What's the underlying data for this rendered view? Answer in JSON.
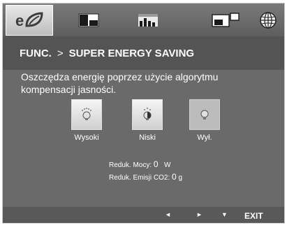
{
  "tabs": [
    {
      "name": "eco-icon",
      "active": true
    },
    {
      "name": "picture-icon",
      "active": false
    },
    {
      "name": "color-icon",
      "active": false
    },
    {
      "name": "pip-icon",
      "active": false
    },
    {
      "name": "globe-icon",
      "active": false
    }
  ],
  "breadcrumb": {
    "section": "FUNC.",
    "separator": ">",
    "page": "SUPER ENERGY SAVING"
  },
  "description": "Oszczędza energię poprzez użycie algorytmu kompensacji jasności.",
  "options": [
    {
      "label": "Wysoki",
      "icon": "bulb-high-icon",
      "state": "on"
    },
    {
      "label": "Niski",
      "icon": "bulb-low-icon",
      "state": "on"
    },
    {
      "label": "Wył.",
      "icon": "bulb-off-icon",
      "state": "selected"
    }
  ],
  "stats": {
    "power_label": "Reduk. Mocy:",
    "power_value": "0",
    "power_unit": "W",
    "co2_label": "Reduk. Emisji CO2:",
    "co2_value": "0",
    "co2_unit": "g"
  },
  "footer": {
    "left_label": "◄",
    "right_label": "►",
    "down_label": "▼",
    "exit_label": "EXIT"
  }
}
